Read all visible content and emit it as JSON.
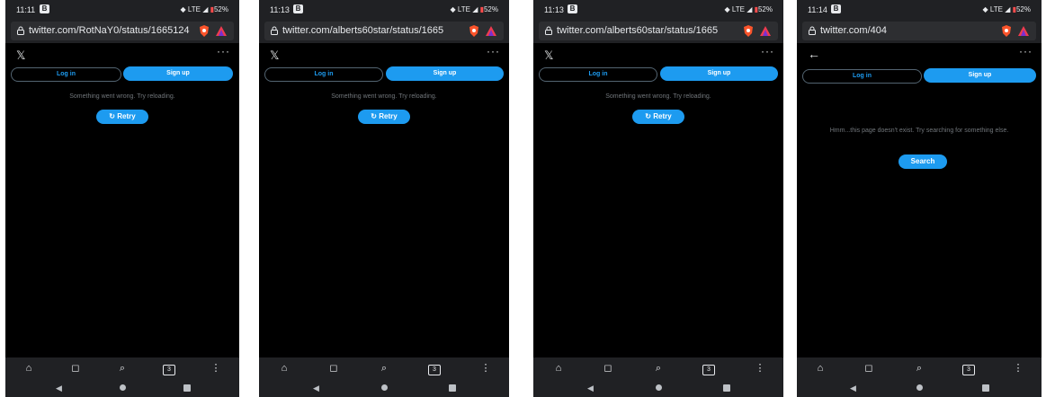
{
  "colors": {
    "accent": "#1d9bf0",
    "background": "#000000",
    "chrome": "#202124",
    "muted_text": "#71767b"
  },
  "icons": {
    "lock": "lock-icon",
    "brave": "brave-shield-icon",
    "rewards": "brave-rewards-icon",
    "x_logo": "x-logo-icon",
    "more": "more-icon",
    "back": "back-arrow-icon",
    "retry": "refresh-icon",
    "home": "home-icon",
    "bookmark": "bookmark-icon",
    "search": "search-icon",
    "tabs": "tabs-icon",
    "menu": "menu-icon"
  },
  "phones": [
    {
      "status": {
        "time": "11:11",
        "notif": "B",
        "signal": "LTE",
        "battery": "52%"
      },
      "url": "twitter.com/RotNaY0/status/1665124",
      "header_icon": "𝕏",
      "login_label": "Log in",
      "signup_label": "Sign up",
      "message": "Something went wrong. Try reloading.",
      "action_label": "Retry",
      "tabs_count": "3"
    },
    {
      "status": {
        "time": "11:13",
        "notif": "B",
        "signal": "LTE",
        "battery": "52%"
      },
      "url": "twitter.com/alberts60star/status/1665",
      "header_icon": "𝕏",
      "login_label": "Log in",
      "signup_label": "Sign up",
      "message": "Something went wrong. Try reloading.",
      "action_label": "Retry",
      "tabs_count": "3"
    },
    {
      "status": {
        "time": "11:13",
        "notif": "B",
        "signal": "LTE",
        "battery": "52%"
      },
      "url": "twitter.com/alberts60star/status/1665",
      "header_icon": "𝕏",
      "login_label": "Log in",
      "signup_label": "Sign up",
      "message": "Something went wrong. Try reloading.",
      "action_label": "Retry",
      "tabs_count": "3"
    },
    {
      "status": {
        "time": "11:14",
        "notif": "B",
        "signal": "LTE",
        "battery": "52%"
      },
      "url": "twitter.com/404",
      "header_icon": "←",
      "login_label": "Log in",
      "signup_label": "Sign up",
      "message": "Hmm...this page doesn't exist. Try searching for something else.",
      "action_label": "Search",
      "tabs_count": "3"
    }
  ]
}
